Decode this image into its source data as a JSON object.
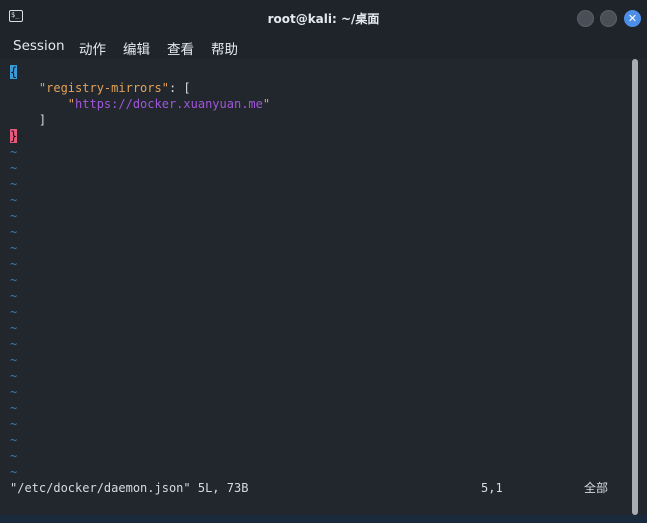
{
  "window": {
    "title": "root@kali: ~/桌面",
    "close_glyph": "✕",
    "terminal_glyph": "$_"
  },
  "menu": {
    "items": [
      "Session",
      "动作",
      "编辑",
      "查看",
      "帮助"
    ]
  },
  "editor": {
    "lines": {
      "l1_brace": "{",
      "l2_indent": "    ",
      "l2_key": "\"registry-mirrors\"",
      "l2_rest": ": [",
      "l3_indent": "        ",
      "l3_quote_open": "\"",
      "l3_url": "https://docker.xuanyuan.me",
      "l3_quote_close": "\"",
      "l4": "    ]",
      "l5_brace": "}"
    },
    "tilde": "~"
  },
  "statusline": {
    "file_info": "\"/etc/docker/daemon.json\" 5L, 73B",
    "cursor_pos": "5,1",
    "scroll_pos": "全部"
  },
  "colors": {
    "background": "#22272e",
    "tilde": "#2f7fb5",
    "json_key": "#e3a35a",
    "json_string": "#a155d9",
    "cursor": "#3b9ad9",
    "matched_brace": "#e35a7c",
    "close_button": "#4d8fe8"
  }
}
